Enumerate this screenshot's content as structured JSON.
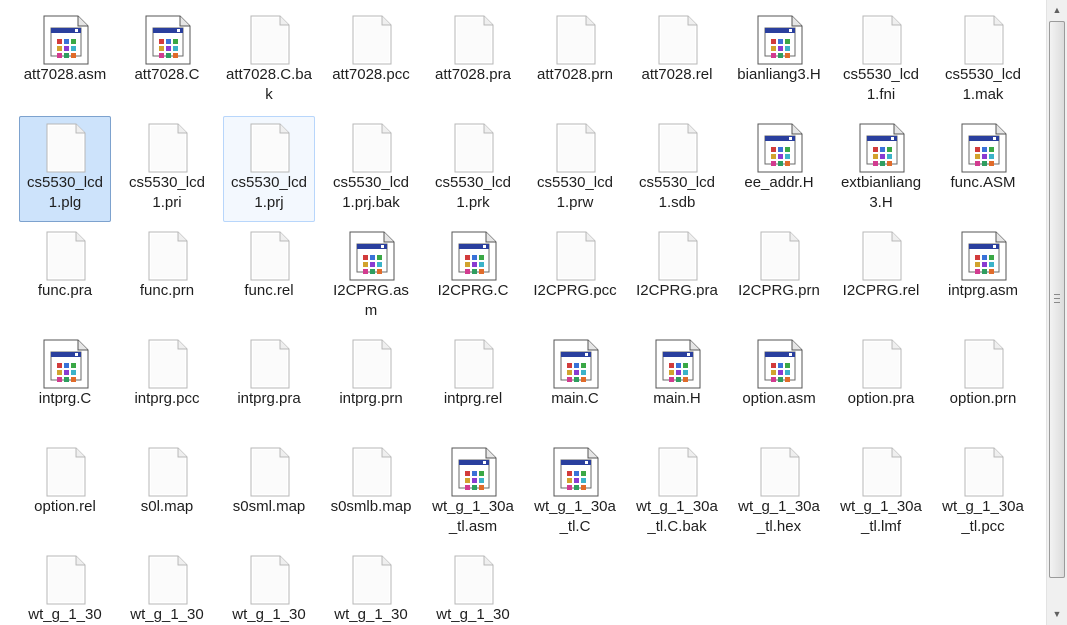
{
  "files": [
    {
      "name": "att7028.asm",
      "icon": "code-file-icon"
    },
    {
      "name": "att7028.C",
      "icon": "code-file-icon"
    },
    {
      "name": "att7028.C.bak",
      "icon": "blank-file-icon"
    },
    {
      "name": "att7028.pcc",
      "icon": "blank-file-icon"
    },
    {
      "name": "att7028.pra",
      "icon": "blank-file-icon"
    },
    {
      "name": "att7028.prn",
      "icon": "blank-file-icon"
    },
    {
      "name": "att7028.rel",
      "icon": "blank-file-icon"
    },
    {
      "name": "bianliang3.H",
      "icon": "code-file-icon"
    },
    {
      "name": "cs5530_lcd1.fni",
      "icon": "blank-file-icon"
    },
    {
      "name": "cs5530_lcd1.mak",
      "icon": "blank-file-icon"
    },
    {
      "name": "cs5530_lcd1.plg",
      "icon": "blank-file-icon",
      "state": "selected"
    },
    {
      "name": "cs5530_lcd1.pri",
      "icon": "blank-file-icon"
    },
    {
      "name": "cs5530_lcd1.prj",
      "icon": "blank-file-icon",
      "state": "hover"
    },
    {
      "name": "cs5530_lcd1.prj.bak",
      "icon": "blank-file-icon"
    },
    {
      "name": "cs5530_lcd1.prk",
      "icon": "blank-file-icon"
    },
    {
      "name": "cs5530_lcd1.prw",
      "icon": "blank-file-icon"
    },
    {
      "name": "cs5530_lcd1.sdb",
      "icon": "blank-file-icon"
    },
    {
      "name": "ee_addr.H",
      "icon": "code-file-icon"
    },
    {
      "name": "extbianliang3.H",
      "icon": "code-file-icon"
    },
    {
      "name": "func.ASM",
      "icon": "code-file-icon"
    },
    {
      "name": "func.pra",
      "icon": "blank-file-icon"
    },
    {
      "name": "func.prn",
      "icon": "blank-file-icon"
    },
    {
      "name": "func.rel",
      "icon": "blank-file-icon"
    },
    {
      "name": "I2CPRG.asm",
      "icon": "code-file-icon"
    },
    {
      "name": "I2CPRG.C",
      "icon": "code-file-icon"
    },
    {
      "name": "I2CPRG.pcc",
      "icon": "blank-file-icon"
    },
    {
      "name": "I2CPRG.pra",
      "icon": "blank-file-icon"
    },
    {
      "name": "I2CPRG.prn",
      "icon": "blank-file-icon"
    },
    {
      "name": "I2CPRG.rel",
      "icon": "blank-file-icon"
    },
    {
      "name": "intprg.asm",
      "icon": "code-file-icon"
    },
    {
      "name": "intprg.C",
      "icon": "code-file-icon"
    },
    {
      "name": "intprg.pcc",
      "icon": "blank-file-icon"
    },
    {
      "name": "intprg.pra",
      "icon": "blank-file-icon"
    },
    {
      "name": "intprg.prn",
      "icon": "blank-file-icon"
    },
    {
      "name": "intprg.rel",
      "icon": "blank-file-icon"
    },
    {
      "name": "main.C",
      "icon": "code-file-icon"
    },
    {
      "name": "main.H",
      "icon": "code-file-icon"
    },
    {
      "name": "option.asm",
      "icon": "code-file-icon"
    },
    {
      "name": "option.pra",
      "icon": "blank-file-icon"
    },
    {
      "name": "option.prn",
      "icon": "blank-file-icon"
    },
    {
      "name": "option.rel",
      "icon": "blank-file-icon"
    },
    {
      "name": "s0l.map",
      "icon": "blank-file-icon"
    },
    {
      "name": "s0sml.map",
      "icon": "blank-file-icon"
    },
    {
      "name": "s0smlb.map",
      "icon": "blank-file-icon"
    },
    {
      "name": "wt_g_1_30a_tl.asm",
      "icon": "code-file-icon"
    },
    {
      "name": "wt_g_1_30a_tl.C",
      "icon": "code-file-icon"
    },
    {
      "name": "wt_g_1_30a_tl.C.bak",
      "icon": "blank-file-icon"
    },
    {
      "name": "wt_g_1_30a_tl.hex",
      "icon": "blank-file-icon"
    },
    {
      "name": "wt_g_1_30a_tl.lmf",
      "icon": "blank-file-icon"
    },
    {
      "name": "wt_g_1_30a_tl.pcc",
      "icon": "blank-file-icon"
    },
    {
      "name": "wt_g_1_30",
      "icon": "blank-file-icon"
    },
    {
      "name": "wt_g_1_30",
      "icon": "blank-file-icon"
    },
    {
      "name": "wt_g_1_30",
      "icon": "blank-file-icon"
    },
    {
      "name": "wt_g_1_30",
      "icon": "blank-file-icon"
    },
    {
      "name": "wt_g_1_30",
      "icon": "blank-file-icon"
    }
  ],
  "scrollbar": {
    "up_arrow": "▲",
    "down_arrow": "▼",
    "position_fraction": 0.0
  },
  "colors": {
    "selection_fill": "#cde3fb",
    "selection_border": "#7da2ce",
    "hover_fill": "#f3f8fe",
    "text": "#1e1e1e"
  }
}
